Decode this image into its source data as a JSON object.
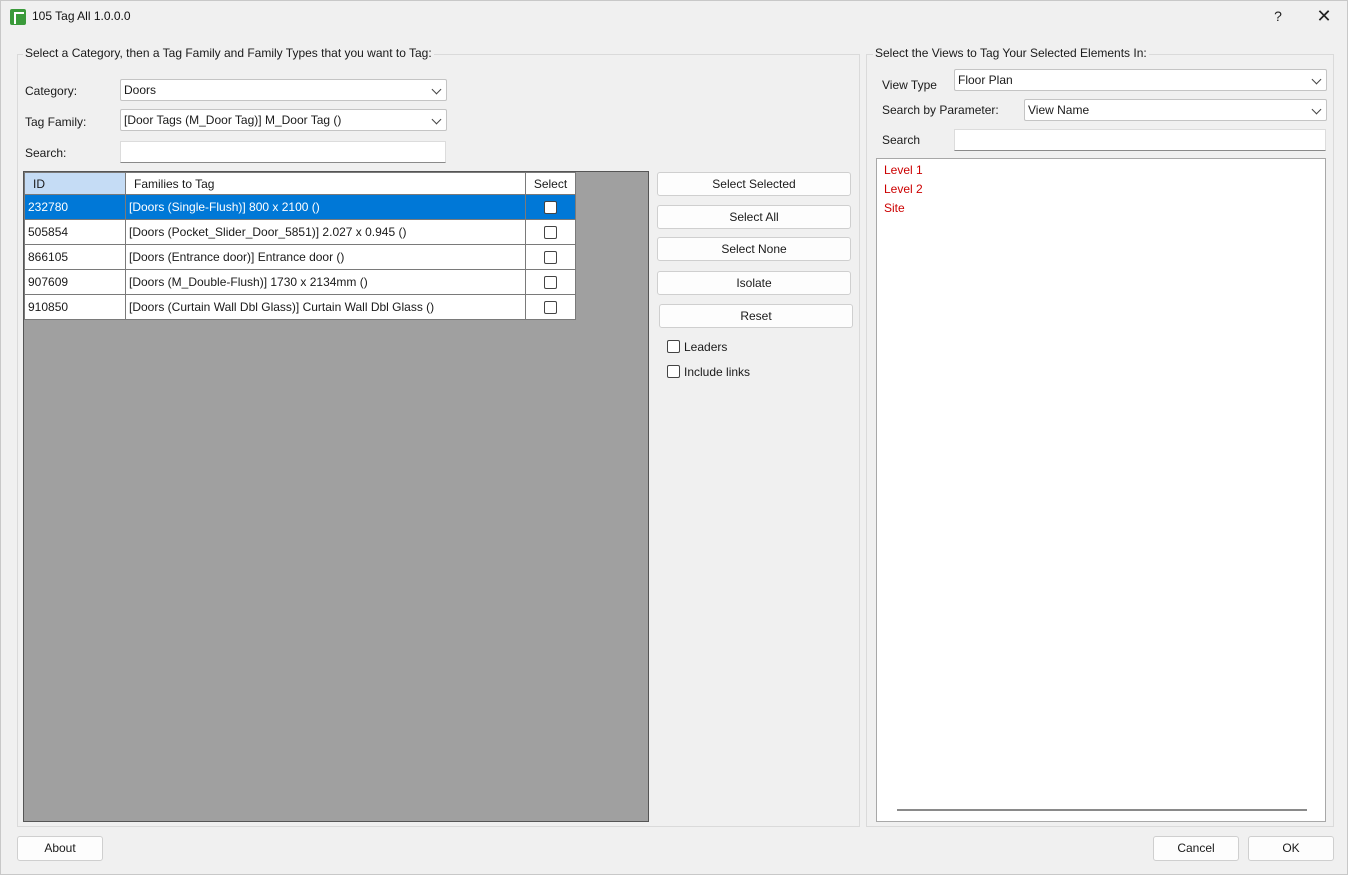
{
  "window": {
    "title": "105 Tag All 1.0.0.0",
    "help_label": "?",
    "close_label": "✕"
  },
  "left": {
    "group_title": "Select a Category, then a Tag Family and Family Types that you want to Tag:",
    "category_label": "Category:",
    "category_value": "Doors",
    "tag_family_label": "Tag Family:",
    "tag_family_value": "[Door Tags (M_Door Tag)] M_Door Tag ()",
    "search_label": "Search:",
    "search_value": "",
    "table": {
      "headers": [
        "ID",
        "Families to Tag",
        "Select"
      ],
      "rows": [
        {
          "id": "232780",
          "family": "[Doors (Single-Flush)] 800 x 2100 ()",
          "checked": false,
          "selected": true
        },
        {
          "id": "505854",
          "family": "[Doors (Pocket_Slider_Door_5851)] 2.027 x 0.945 ()",
          "checked": false,
          "selected": false
        },
        {
          "id": "866105",
          "family": "[Doors (Entrance door)] Entrance door ()",
          "checked": false,
          "selected": false
        },
        {
          "id": "907609",
          "family": "[Doors (M_Double-Flush)] 1730 x 2134mm ()",
          "checked": false,
          "selected": false
        },
        {
          "id": "910850",
          "family": "[Doors (Curtain Wall Dbl Glass)] Curtain Wall Dbl Glass ()",
          "checked": false,
          "selected": false
        }
      ]
    }
  },
  "actions": {
    "select_selected": "Select Selected",
    "select_all": "Select All",
    "select_none": "Select None",
    "isolate": "Isolate",
    "reset": "Reset",
    "leaders_label": "Leaders",
    "include_links_label": "Include links"
  },
  "right": {
    "group_title": "Select the Views to Tag Your Selected Elements In:",
    "view_type_label": "View Type",
    "view_type_value": "Floor Plan",
    "search_by_label": "Search by Parameter:",
    "search_by_value": "View Name",
    "search_label": "Search",
    "search_value": "",
    "views": [
      "Level 1",
      "Level 2",
      "Site"
    ],
    "view_item_color": "#cc0000"
  },
  "footer": {
    "about": "About",
    "cancel": "Cancel",
    "ok": "OK"
  }
}
